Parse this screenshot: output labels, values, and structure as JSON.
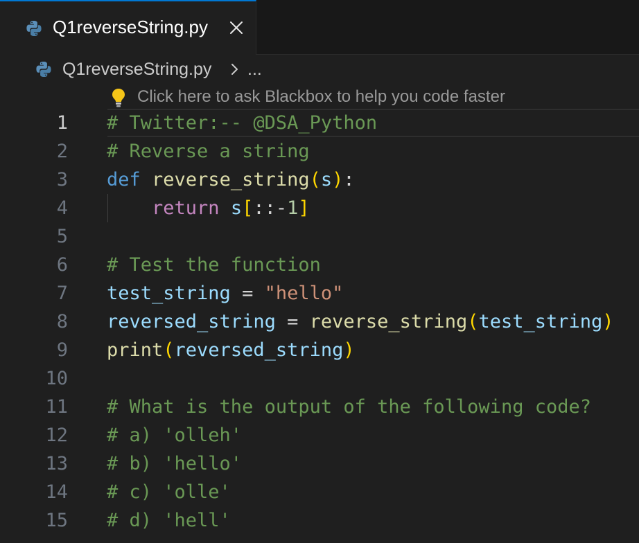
{
  "tab": {
    "label": "Q1reverseString.py",
    "icon": "python-icon",
    "close_icon": "close-icon"
  },
  "breadcrumb": {
    "file": "Q1reverseString.py",
    "more": "..."
  },
  "hint": {
    "text": "Click here to ask Blackbox to help you code faster",
    "icon": "lightbulb-icon"
  },
  "editor": {
    "active_line": 1,
    "colors": {
      "background": "#1f1f1f",
      "comment": "#6a9955",
      "keyword": "#569cd6",
      "control": "#c586c0",
      "function": "#dcdcaa",
      "variable": "#9cdcfe",
      "string": "#ce9178",
      "number": "#b5cea8",
      "bracket": "#ffd700",
      "tab_accent": "#0078d4"
    },
    "lines": [
      {
        "number": "1",
        "tokens": [
          {
            "t": "# Twitter:-- @DSA_Python",
            "c": "comment"
          }
        ]
      },
      {
        "number": "2",
        "tokens": [
          {
            "t": "# Reverse a string",
            "c": "comment"
          }
        ]
      },
      {
        "number": "3",
        "tokens": [
          {
            "t": "def",
            "c": "keyword"
          },
          {
            "t": " ",
            "c": "op"
          },
          {
            "t": "reverse_string",
            "c": "func"
          },
          {
            "t": "(",
            "c": "brace1"
          },
          {
            "t": "s",
            "c": "var"
          },
          {
            "t": ")",
            "c": "brace1"
          },
          {
            "t": ":",
            "c": "op"
          }
        ]
      },
      {
        "number": "4",
        "tokens": [
          {
            "t": "    ",
            "c": "op"
          },
          {
            "t": "return",
            "c": "control"
          },
          {
            "t": " ",
            "c": "op"
          },
          {
            "t": "s",
            "c": "var"
          },
          {
            "t": "[",
            "c": "brace1"
          },
          {
            "t": "::",
            "c": "op"
          },
          {
            "t": "-",
            "c": "op"
          },
          {
            "t": "1",
            "c": "number"
          },
          {
            "t": "]",
            "c": "brace1"
          }
        ]
      },
      {
        "number": "5",
        "tokens": []
      },
      {
        "number": "6",
        "tokens": [
          {
            "t": "# Test the function",
            "c": "comment"
          }
        ]
      },
      {
        "number": "7",
        "tokens": [
          {
            "t": "test_string",
            "c": "var"
          },
          {
            "t": " = ",
            "c": "op"
          },
          {
            "t": "\"hello\"",
            "c": "string"
          }
        ]
      },
      {
        "number": "8",
        "tokens": [
          {
            "t": "reversed_string",
            "c": "var"
          },
          {
            "t": " = ",
            "c": "op"
          },
          {
            "t": "reverse_string",
            "c": "func"
          },
          {
            "t": "(",
            "c": "brace1"
          },
          {
            "t": "test_string",
            "c": "var"
          },
          {
            "t": ")",
            "c": "brace1"
          }
        ]
      },
      {
        "number": "9",
        "tokens": [
          {
            "t": "print",
            "c": "func"
          },
          {
            "t": "(",
            "c": "brace1"
          },
          {
            "t": "reversed_string",
            "c": "var"
          },
          {
            "t": ")",
            "c": "brace1"
          }
        ]
      },
      {
        "number": "10",
        "tokens": []
      },
      {
        "number": "11",
        "tokens": [
          {
            "t": "# What is the output of the following code?",
            "c": "comment"
          }
        ]
      },
      {
        "number": "12",
        "tokens": [
          {
            "t": "# a) 'olleh'",
            "c": "comment"
          }
        ]
      },
      {
        "number": "13",
        "tokens": [
          {
            "t": "# b) 'hello'",
            "c": "comment"
          }
        ]
      },
      {
        "number": "14",
        "tokens": [
          {
            "t": "# c) 'olle'",
            "c": "comment"
          }
        ]
      },
      {
        "number": "15",
        "tokens": [
          {
            "t": "# d) 'hell'",
            "c": "comment"
          }
        ]
      }
    ]
  }
}
